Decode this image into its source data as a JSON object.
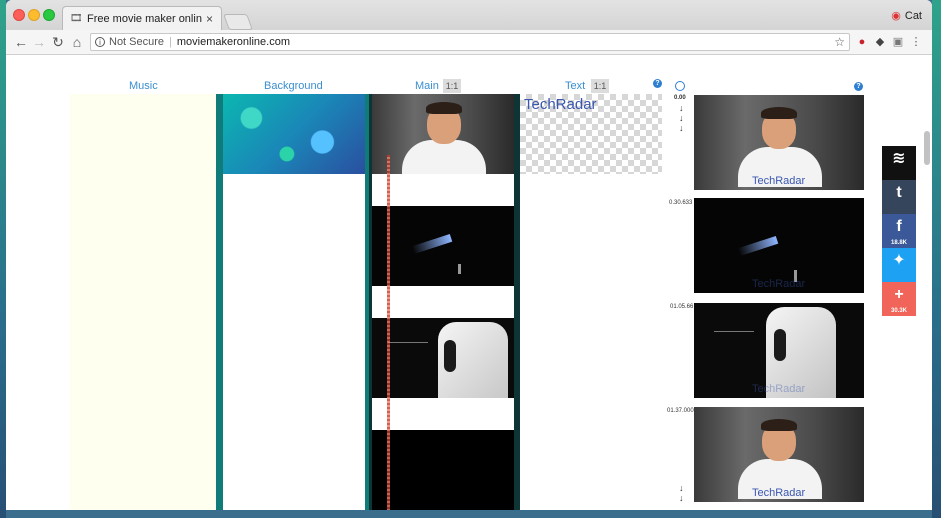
{
  "browser": {
    "tab_title": "Free movie maker online and",
    "tab_close": "×",
    "profile_name": "Cat",
    "not_secure_label": "Not Secure",
    "url": "moviemakeronline.com",
    "separator": "|"
  },
  "editor": {
    "columns": {
      "music": "Music",
      "background": "Background",
      "main": "Main",
      "text": "Text"
    },
    "ratio_badge": "1:1",
    "help_glyph": "?",
    "text_clip_label": "TechRadar",
    "watermark": "TechRadar",
    "timecodes": [
      "0.00",
      "0.30.633",
      "01.05.66",
      "01.37.000"
    ],
    "arrow_glyph": "↓"
  },
  "share": {
    "buffer_glyph": "≋",
    "tumblr_glyph": "t",
    "facebook_glyph": "f",
    "facebook_count": "18.8K",
    "twitter_glyph": "✦",
    "more_glyph": "+",
    "more_count": "30.3K"
  },
  "colors": {
    "link_blue": "#3a8fd1",
    "teal": "#0f7c7a",
    "facebook": "#3b5998",
    "twitter": "#1da1f2",
    "more": "#f0645a",
    "tumblr": "#35465c"
  }
}
